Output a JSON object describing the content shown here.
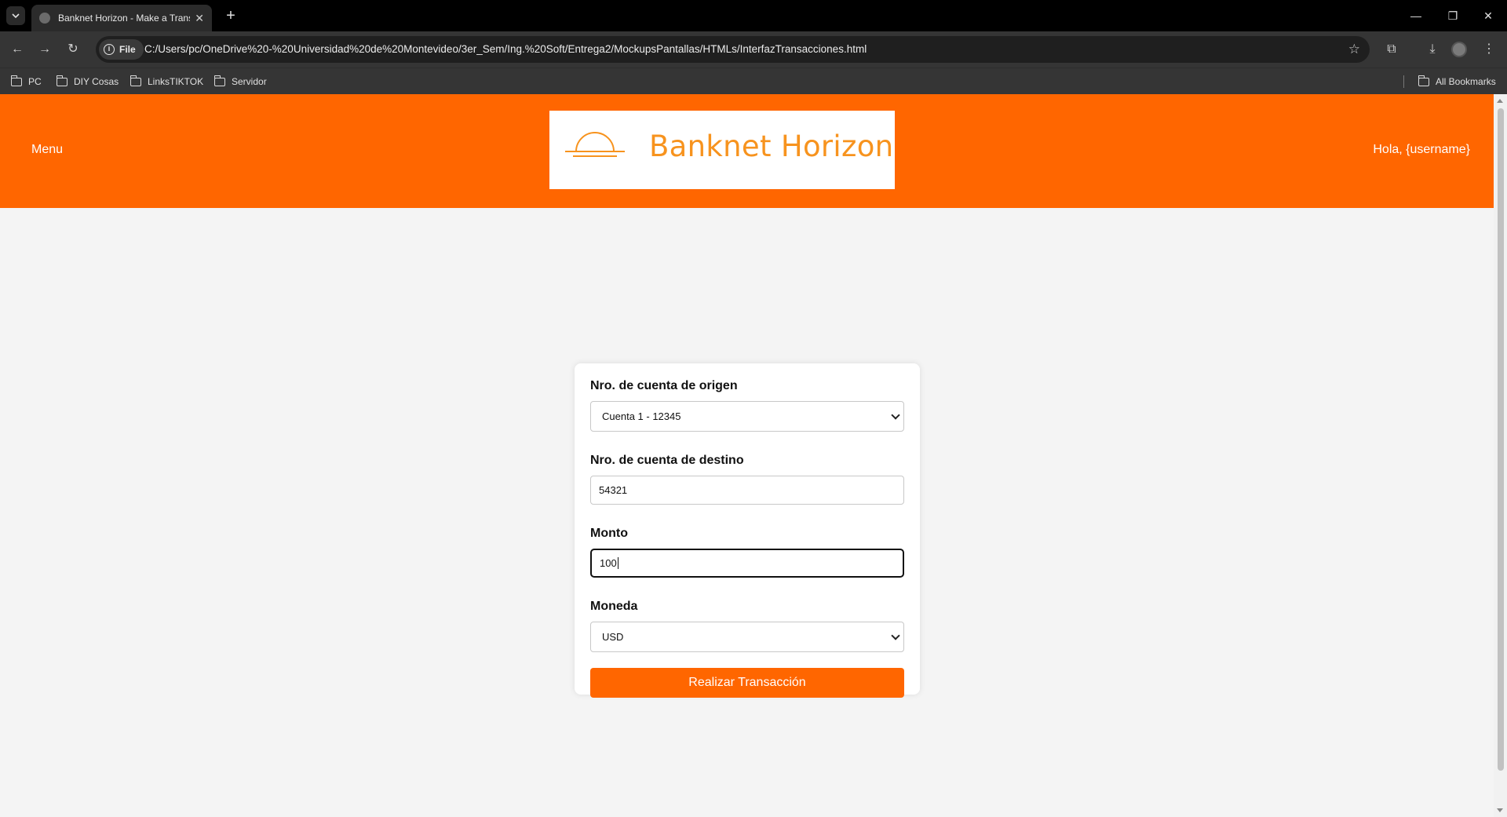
{
  "browser": {
    "tab_title": "Banknet Horizon - Make a Transaction",
    "site_chip": "File",
    "url": "C:/Users/pc/OneDrive%20-%20Universidad%20de%20Montevideo/3er_Sem/Ing.%20Soft/Entrega2/MockupsPantallas/HTMLs/InterfazTransacciones.html",
    "bookmarks": [
      "PC",
      "DIY Cosas",
      "LinksTIKTOK",
      "Servidor"
    ],
    "all_bookmarks": "All Bookmarks"
  },
  "header": {
    "menu_label": "Menu",
    "logo_text": "Banknet Horizon",
    "greeting": "Hola, {username}",
    "bg_color": "#ff6600",
    "logo_color": "#f7931e"
  },
  "form": {
    "origin_label": "Nro. de cuenta de origen",
    "origin_value": "Cuenta 1 - 12345",
    "destination_label": "Nro. de cuenta de destino",
    "destination_value": "54321",
    "amount_label": "Monto",
    "amount_value": "100",
    "currency_label": "Moneda",
    "currency_value": "USD",
    "submit_label": "Realizar Transacción"
  }
}
